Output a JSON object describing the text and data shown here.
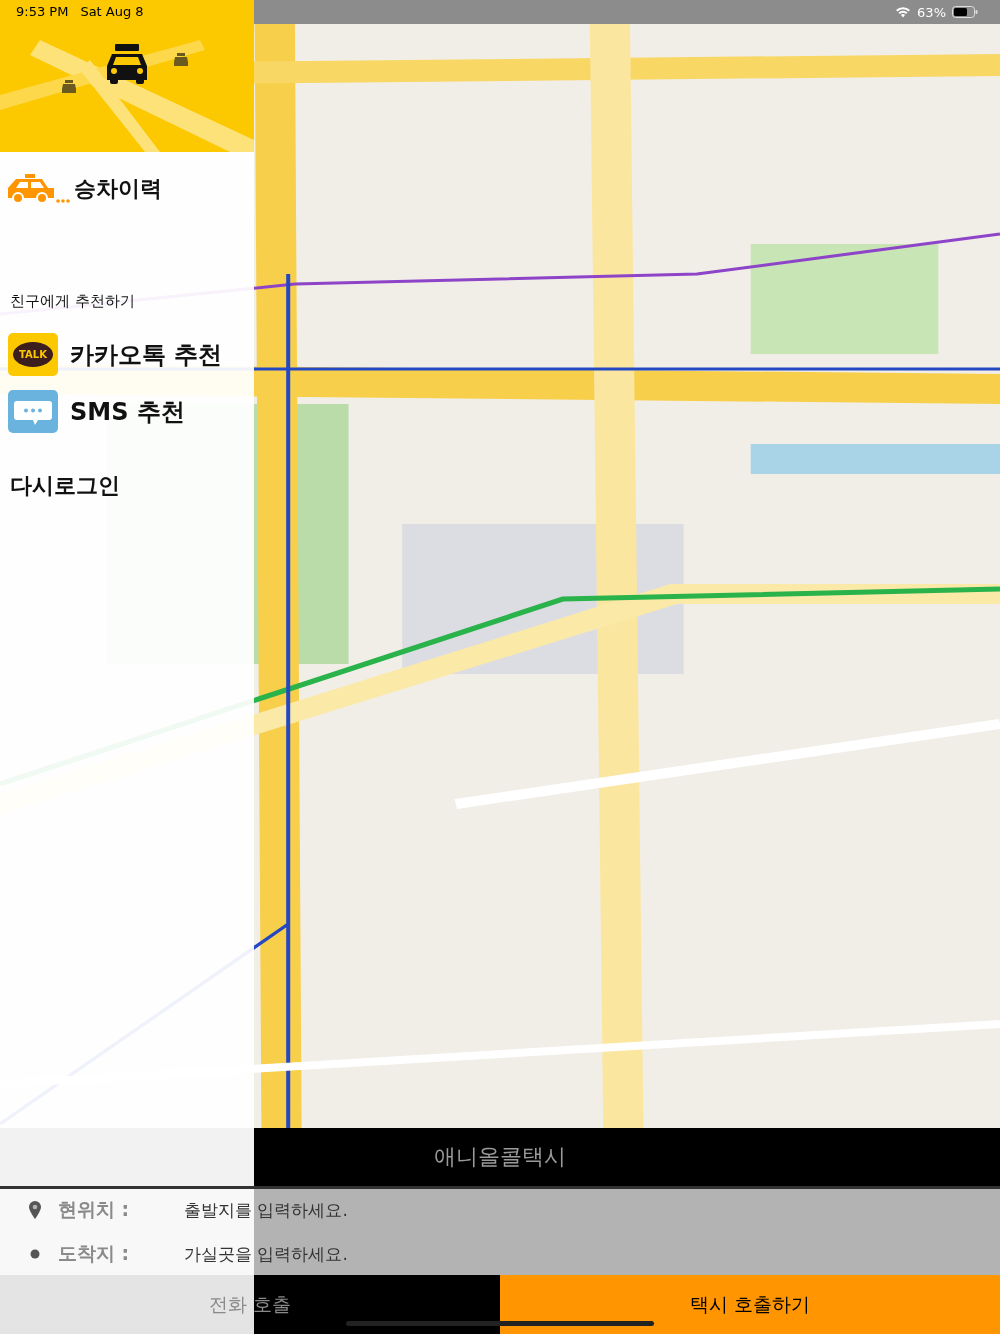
{
  "status_bar": {
    "time": "9:53 PM",
    "date": "Sat Aug 8",
    "battery": "63%"
  },
  "drawer": {
    "history": "승차이력",
    "recommend_heading": "친구에게 추천하기",
    "recommend_items": [
      {
        "kind": "kakao",
        "icon_text": "TALK",
        "label": "카카오톡 추천"
      },
      {
        "kind": "sms",
        "label": "SMS 추천"
      }
    ],
    "relogin": "다시로그인"
  },
  "app_title": "애니올콜택시",
  "route": [
    {
      "kind": "origin",
      "label": "현위치 :",
      "placeholder": "출발지를 입력하세요."
    },
    {
      "kind": "destination",
      "label": "도착지 :",
      "placeholder": "가실곳을 입력하세요."
    }
  ],
  "buttons": [
    {
      "kind": "phone",
      "label": "전화 호출"
    },
    {
      "kind": "taxi",
      "label": "택시 호출하기"
    }
  ]
}
